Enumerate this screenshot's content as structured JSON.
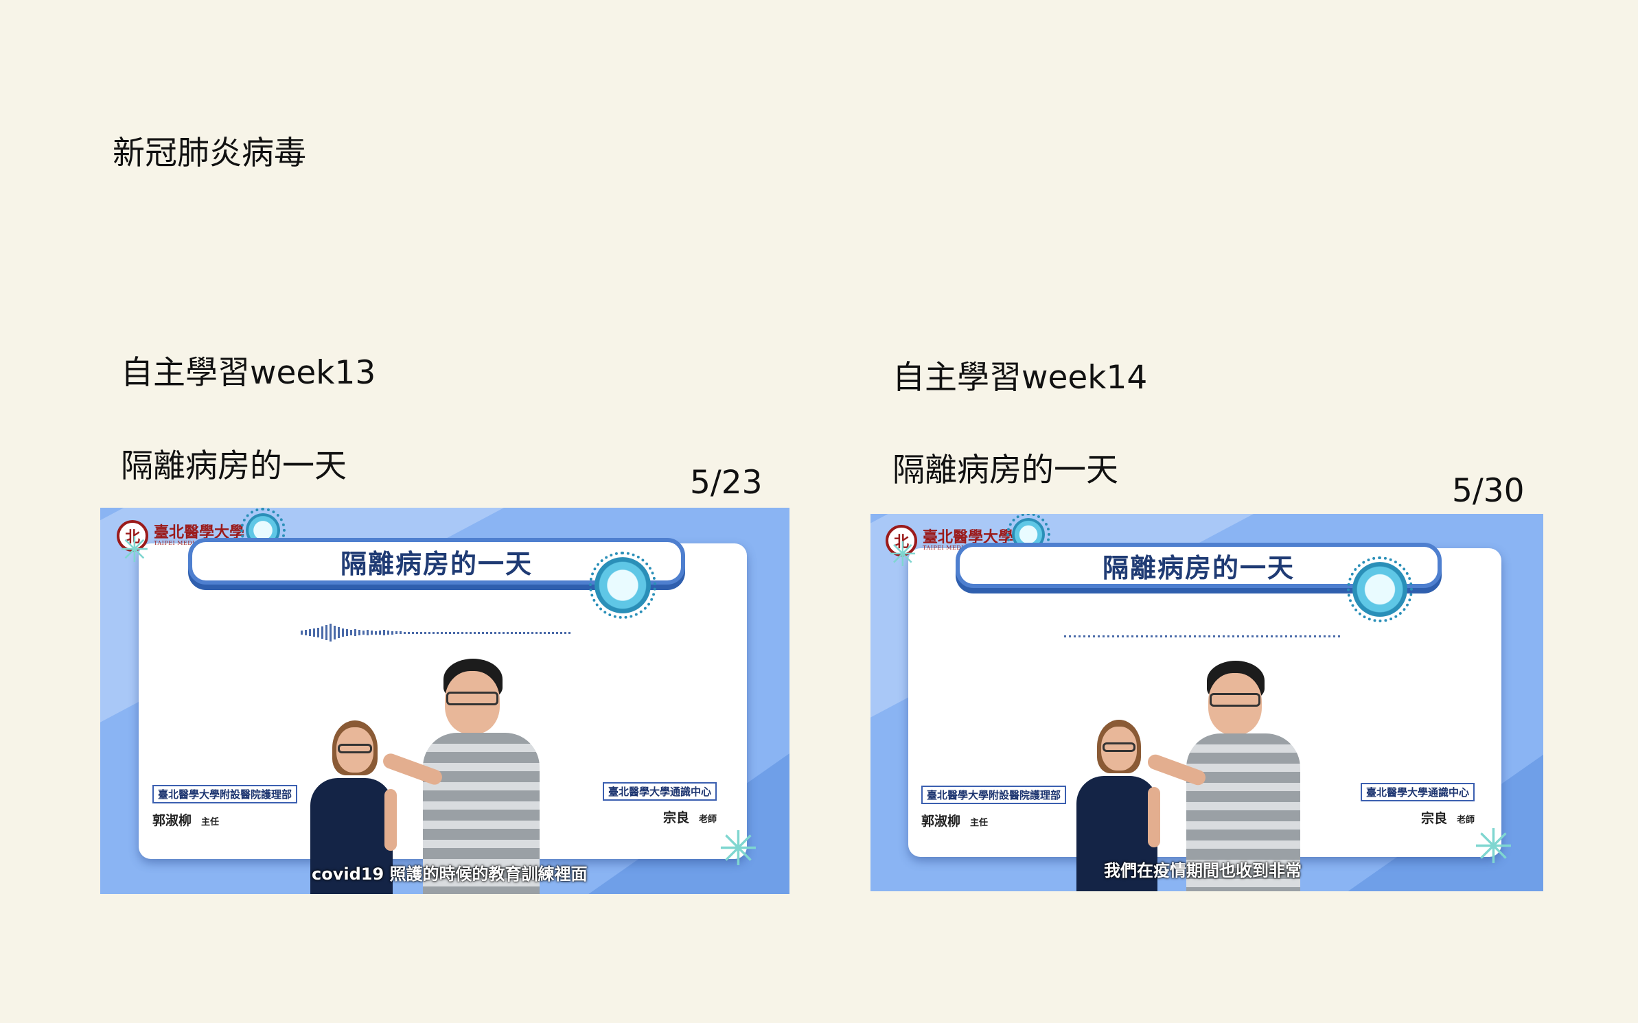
{
  "page": {
    "title": "新冠肺炎病毒"
  },
  "sections": [
    {
      "heading": "自主學習week13",
      "topic": "隔離病房的一天",
      "date": "5/23",
      "video": {
        "banner_title": "隔離病房的一天",
        "logo_seal": "北",
        "logo_cn": "臺北醫學大學",
        "logo_en": "TAIPEI MEDICAL UNIVERSITY",
        "left_org": "臺北醫學大學附設醫院護理部",
        "left_name": "郭淑柳",
        "left_title": "主任",
        "right_org": "臺北醫學大學通識中心",
        "right_name": "宗良",
        "right_title": "老師",
        "subtitle": "covid19 照護的時候的教育訓練裡面"
      }
    },
    {
      "heading": "自主學習week14",
      "topic": "隔離病房的一天",
      "date": "5/30",
      "video": {
        "banner_title": "隔離病房的一天",
        "logo_seal": "北",
        "logo_cn": "臺北醫學大學",
        "logo_en": "TAIPEI MEDICAL UNIVERSITY",
        "left_org": "臺北醫學大學附設醫院護理部",
        "left_name": "郭淑柳",
        "left_title": "主任",
        "right_org": "臺北醫學大學通識中心",
        "right_name": "宗良",
        "right_title": "老師",
        "subtitle": "我們在疫情期間也收到非常"
      }
    }
  ]
}
